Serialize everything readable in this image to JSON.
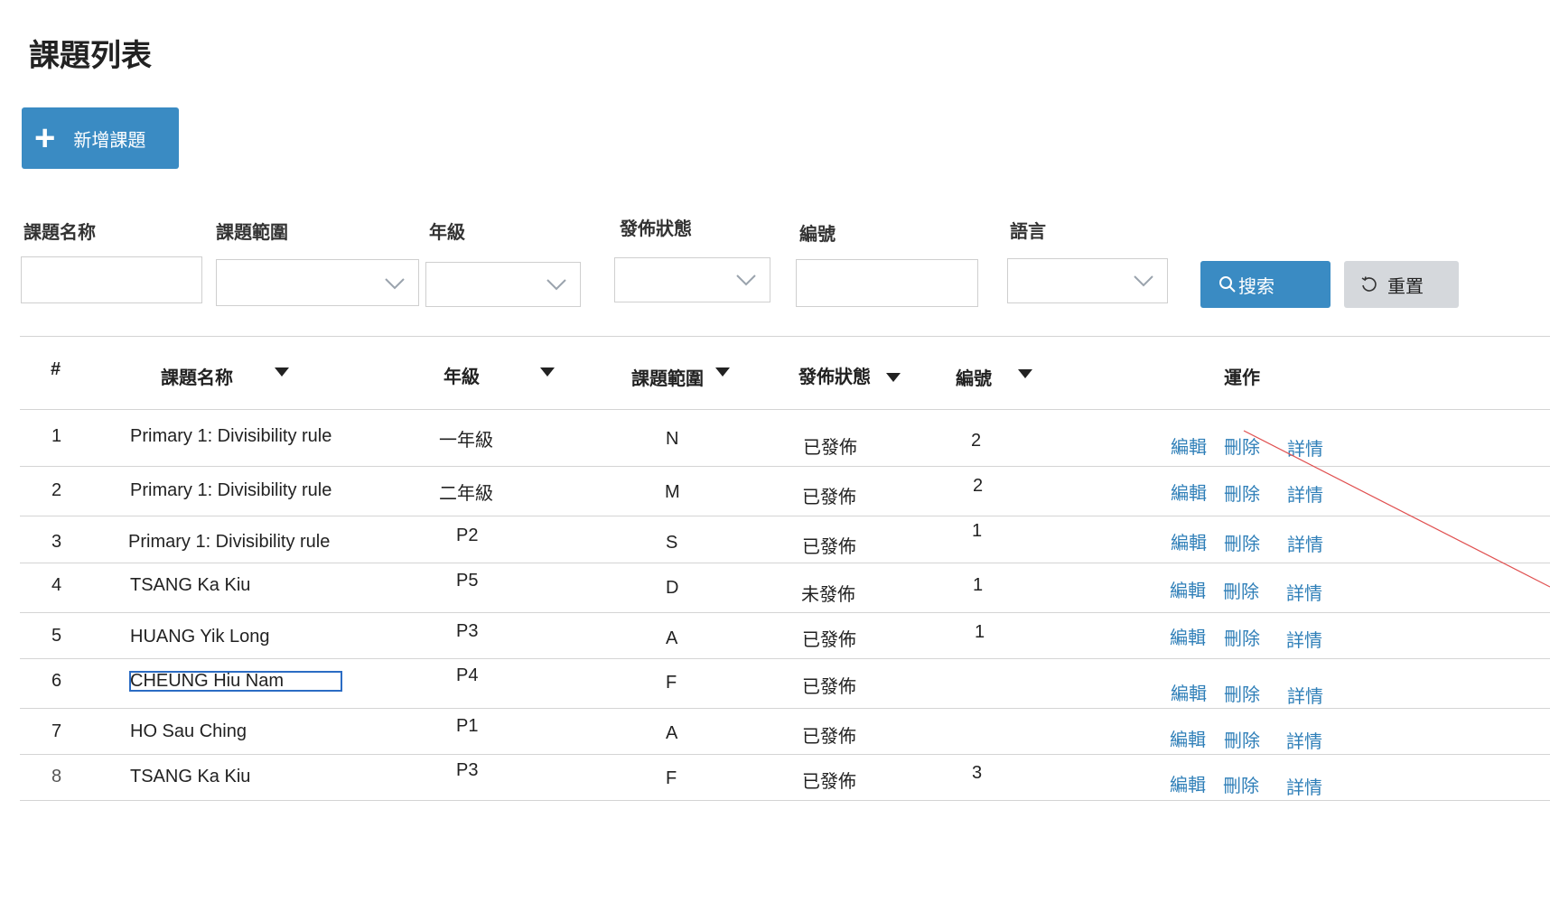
{
  "header": {
    "title": "課題列表"
  },
  "toolbar": {
    "add_label": "新增課題"
  },
  "filters": {
    "name_label": "課題名称",
    "scope_label": "課題範圍",
    "grade_label": "年級",
    "status_label": "發佈狀態",
    "code_label": "編號",
    "language_label": "語言",
    "search_label": "搜索",
    "reset_label": "重置"
  },
  "table": {
    "columns": {
      "index": "#",
      "name": "課題名称",
      "grade": "年級",
      "scope": "課題範圍",
      "status": "發佈狀態",
      "code": "編號",
      "actions": "運作"
    },
    "actions": {
      "edit": "編輯",
      "delete": "刪除",
      "detail": "詳情"
    },
    "rows": [
      {
        "index": "1",
        "name": "Primary 1: Divisibility rule",
        "grade": "一年級",
        "scope": "N",
        "status": "已發佈",
        "code": "2"
      },
      {
        "index": "2",
        "name": "Primary 1: Divisibility rule",
        "grade": "二年級",
        "scope": "M",
        "status": "已發佈",
        "code": "2"
      },
      {
        "index": "3",
        "name": "Primary 1: Divisibility rule",
        "grade": "P2",
        "scope": "S",
        "status": "已發佈",
        "code": "1"
      },
      {
        "index": "4",
        "name": "TSANG Ka Kiu",
        "grade": "P5",
        "scope": "D",
        "status": "未發佈",
        "code": "1"
      },
      {
        "index": "5",
        "name": "HUANG Yik Long",
        "grade": "P3",
        "scope": "A",
        "status": "已發佈",
        "code": "1"
      },
      {
        "index": "6",
        "name": "CHEUNG Hiu Nam",
        "grade": "P4",
        "scope": "F",
        "status": "已發佈",
        "code": ""
      },
      {
        "index": "7",
        "name": "HO Sau Ching",
        "grade": "P1",
        "scope": "A",
        "status": "已發佈",
        "code": ""
      },
      {
        "index": "8",
        "name": "TSANG Ka Kiu",
        "grade": "P3",
        "scope": "F",
        "status": "已發佈",
        "code": "3"
      }
    ]
  },
  "icons": {
    "add": "plus-icon",
    "search": "search-icon",
    "reset": "reset-icon",
    "dropdown": "chevron-down-icon",
    "sort": "sort-down-icon"
  },
  "colors": {
    "primary": "#3a8bc3",
    "link": "#2f7fb8",
    "reset_bg": "#d5d8dc",
    "selection": "#2b6cc4",
    "annotation": "#e05050"
  }
}
